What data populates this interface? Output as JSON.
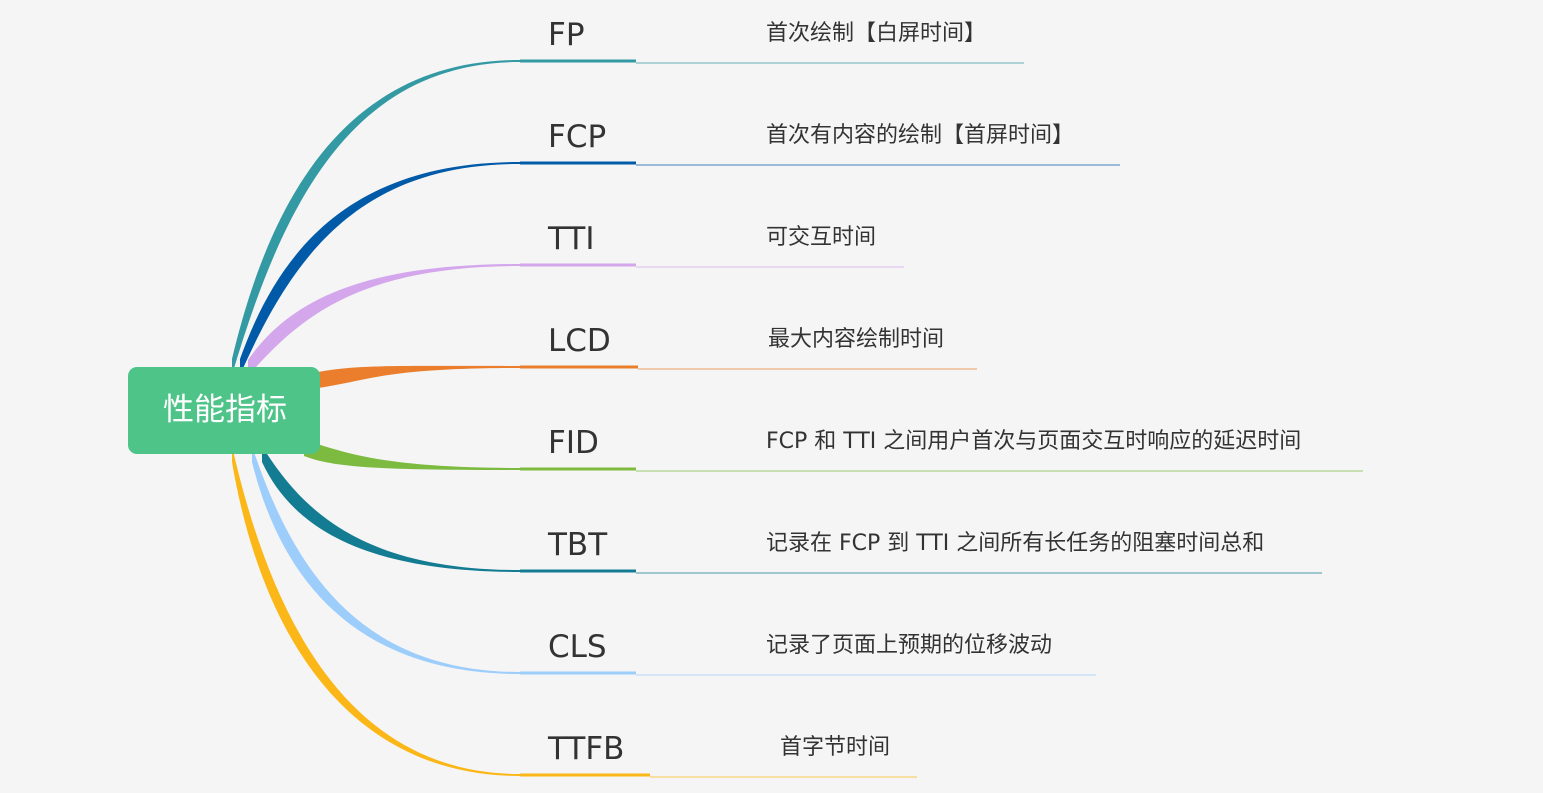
{
  "root": {
    "label": "性能指标",
    "color": "#4fc489"
  },
  "branches": [
    {
      "key": "fp",
      "label": "FP",
      "description": "首次绘制【白屏时间】",
      "color": "#3399a3"
    },
    {
      "key": "fcp",
      "label": "FCP",
      "description": "首次有内容的绘制【首屏时间】",
      "color": "#005aa8"
    },
    {
      "key": "tti",
      "label": "TTI",
      "description": "可交互时间",
      "color": "#d4a7ec"
    },
    {
      "key": "lcd",
      "label": "LCD",
      "description": "最大内容绘制时间",
      "color": "#ea7e2c"
    },
    {
      "key": "fid",
      "label": "FID",
      "description": "FCP 和 TTI 之间用户首次与页面交互时响应的延迟时间",
      "color": "#7dbb40"
    },
    {
      "key": "tbt",
      "label": "TBT",
      "description": "记录在 FCP 到 TTI 之间所有长任务的阻塞时间总和",
      "color": "#137b92"
    },
    {
      "key": "cls",
      "label": "CLS",
      "description": "记录了页面上预期的位移波动",
      "color": "#9dcdfb"
    },
    {
      "key": "ttfb",
      "label": "TTFB",
      "description": "首字节时间",
      "color": "#fbb718"
    }
  ]
}
